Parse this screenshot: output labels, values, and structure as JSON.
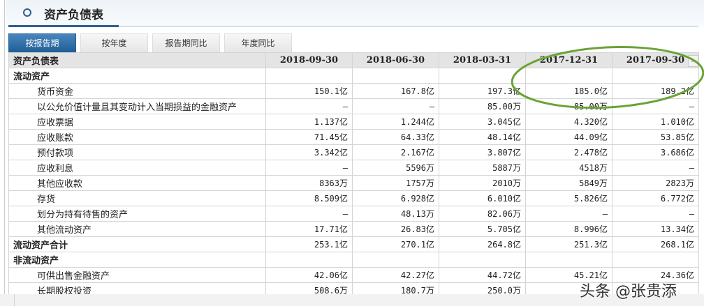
{
  "section_title": "资产负债表",
  "tabs": [
    "按报告期",
    "按年度",
    "报告期同比",
    "年度同比"
  ],
  "table": {
    "header": [
      "资产负债表",
      "2018-09-30",
      "2018-06-30",
      "2018-03-31",
      "2017-12-31",
      "2017-09-30"
    ],
    "more_icon": "»",
    "rows": [
      {
        "label": "流动资产",
        "type": "section",
        "values": [
          "",
          "",
          "",
          "",
          ""
        ]
      },
      {
        "label": "货币资金",
        "type": "sub",
        "values": [
          "150.1亿",
          "167.8亿",
          "197.3亿",
          "185.0亿",
          "189.2亿"
        ]
      },
      {
        "label": "以公允价值计量且其变动计入当期损益的金融资产",
        "type": "sub",
        "values": [
          "—",
          "—",
          "85.00万",
          "85.00万",
          "—"
        ]
      },
      {
        "label": "应收票据",
        "type": "sub",
        "values": [
          "1.137亿",
          "1.244亿",
          "3.045亿",
          "4.320亿",
          "1.010亿"
        ]
      },
      {
        "label": "应收账款",
        "type": "sub",
        "values": [
          "71.45亿",
          "64.33亿",
          "48.14亿",
          "44.09亿",
          "53.85亿"
        ]
      },
      {
        "label": "预付款项",
        "type": "sub",
        "values": [
          "3.342亿",
          "2.167亿",
          "3.807亿",
          "2.478亿",
          "3.686亿"
        ]
      },
      {
        "label": "应收利息",
        "type": "sub",
        "values": [
          "—",
          "5596万",
          "5887万",
          "4518万",
          "—"
        ]
      },
      {
        "label": "其他应收款",
        "type": "sub",
        "values": [
          "8363万",
          "1757万",
          "2010万",
          "5849万",
          "2823万"
        ]
      },
      {
        "label": "存货",
        "type": "sub",
        "values": [
          "8.509亿",
          "6.928亿",
          "6.010亿",
          "5.826亿",
          "6.772亿"
        ]
      },
      {
        "label": "划分为持有待售的资产",
        "type": "sub",
        "values": [
          "—",
          "48.13万",
          "82.06万",
          "—",
          "—"
        ]
      },
      {
        "label": "其他流动资产",
        "type": "sub",
        "values": [
          "17.71亿",
          "26.83亿",
          "5.705亿",
          "8.996亿",
          "13.34亿"
        ]
      },
      {
        "label": "流动资产合计",
        "type": "section",
        "values": [
          "253.1亿",
          "270.1亿",
          "264.8亿",
          "251.3亿",
          "268.1亿"
        ]
      },
      {
        "label": "非流动资产",
        "type": "section",
        "values": [
          "",
          "",
          "",
          "",
          ""
        ]
      },
      {
        "label": "可供出售金融资产",
        "type": "sub",
        "values": [
          "42.06亿",
          "42.27亿",
          "44.72亿",
          "45.21亿",
          "24.36亿"
        ]
      },
      {
        "label": "长期股权投资",
        "type": "sub",
        "values": [
          "508.6万",
          "180.7万",
          "250.0万",
          "",
          ""
        ]
      }
    ]
  },
  "highlight_color": "#6aa336",
  "watermark": "头条 @张贵添"
}
